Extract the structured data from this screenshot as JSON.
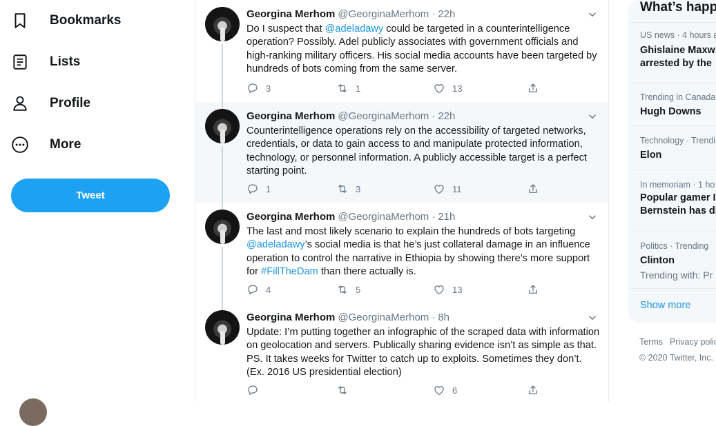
{
  "nav": {
    "items": [
      {
        "label": "Bookmarks",
        "icon": "bookmark-icon"
      },
      {
        "label": "Lists",
        "icon": "list-icon"
      },
      {
        "label": "Profile",
        "icon": "profile-icon"
      },
      {
        "label": "More",
        "icon": "more-icon"
      }
    ],
    "tweet_button": "Tweet"
  },
  "tweets": [
    {
      "name": "Georgina Merhom",
      "handle": "@GeorginaMerhom",
      "dot": "·",
      "time": "22h",
      "text_parts": [
        {
          "t": "Do I suspect that "
        },
        {
          "t": "@adeladawy",
          "link": true
        },
        {
          "t": " could be targeted in a counterintelligence operation? Possibly. Adel publicly associates with government officials and high-ranking military officers. His social media accounts have been targeted by hundreds of bots coming from the same server."
        }
      ],
      "replies": "3",
      "retweets": "1",
      "likes": "13"
    },
    {
      "name": "Georgina Merhom",
      "handle": "@GeorginaMerhom",
      "dot": "·",
      "time": "22h",
      "text_parts": [
        {
          "t": "Counterintelligence operations rely on the accessibility of targeted networks, credentials, or data to gain access to and manipulate protected information, technology, or personnel information. A publicly accessible target is a perfect starting point."
        }
      ],
      "replies": "1",
      "retweets": "3",
      "likes": "11"
    },
    {
      "name": "Georgina Merhom",
      "handle": "@GeorginaMerhom",
      "dot": "·",
      "time": "21h",
      "text_parts": [
        {
          "t": "The last and most likely scenario to explain the hundreds of bots targeting "
        },
        {
          "t": "@adeladawy",
          "link": true
        },
        {
          "t": "’s social media is that he’s just collateral damage in an influence operation to control the narrative in Ethiopia by showing there’s more support for "
        },
        {
          "t": "#FillTheDam",
          "link": true
        },
        {
          "t": " than there actually is."
        }
      ],
      "replies": "4",
      "retweets": "5",
      "likes": "13"
    },
    {
      "name": "Georgina Merhom",
      "handle": "@GeorginaMerhom",
      "dot": "·",
      "time": "8h",
      "text_parts": [
        {
          "t": "Update: I’m putting together an infographic of the scraped data with information on geolocation and servers. Publically sharing evidence isn’t as simple as that. PS. It takes weeks for Twitter to catch up to exploits. Sometimes they don’t. (Ex. 2016 US presidential election)"
        }
      ],
      "replies": "",
      "retweets": "",
      "likes": "6"
    }
  ],
  "sidebar": {
    "title": "What’s happ",
    "trends": [
      {
        "meta": "US news · 4 hours a",
        "name": "Ghislaine Maxw\narrested by the",
        "sub": ""
      },
      {
        "meta": "Trending in Canada",
        "name": "Hugh Downs",
        "sub": ""
      },
      {
        "meta": "Technology · Trendi",
        "name": "Elon",
        "sub": ""
      },
      {
        "meta": "In memoriam · 1 ho",
        "name": "Popular gamer I\nBernstein has di",
        "sub": ""
      },
      {
        "meta": "Politics · Trending",
        "name": "Clinton",
        "sub": "Trending with: Pr"
      }
    ],
    "show_more": "Show more",
    "footer_terms": "Terms",
    "footer_privacy": "Privacy polic",
    "copyright": "© 2020 Twitter, Inc."
  },
  "colors": {
    "accent": "#1da1f2",
    "link": "#1b95e0",
    "muted": "#657786",
    "highlight_bg": "#f5f8fa"
  }
}
